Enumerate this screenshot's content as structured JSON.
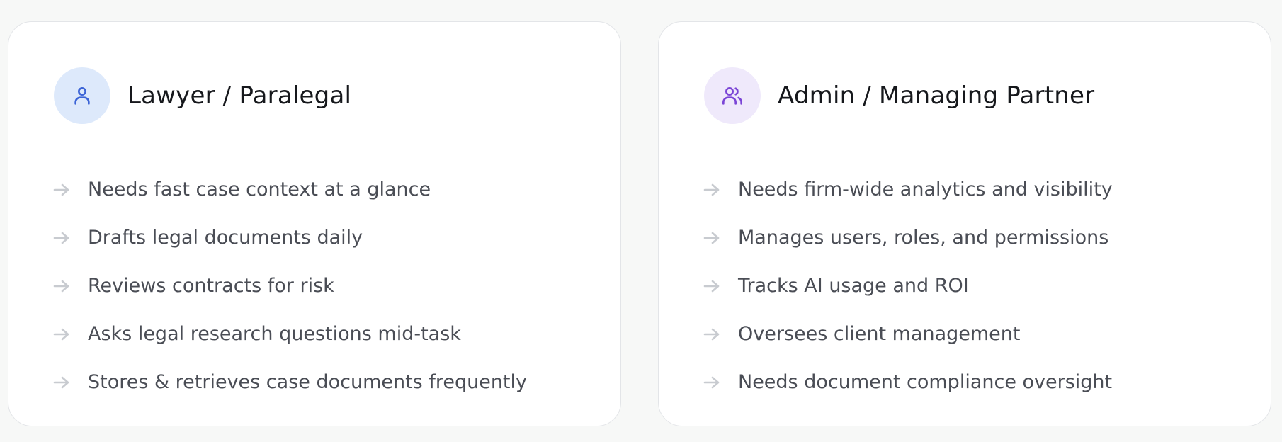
{
  "cards": [
    {
      "title": "Lawyer / Paralegal",
      "icon": "user-icon",
      "icon_bg": "#dde9fb",
      "icon_color": "#3c64d6",
      "items": [
        "Needs fast case context at a glance",
        "Drafts legal documents daily",
        "Reviews contracts for risk",
        "Asks legal research questions mid-task",
        "Stores & retrieves case documents frequently"
      ]
    },
    {
      "title": "Admin / Managing Partner",
      "icon": "users-icon",
      "icon_bg": "#efe9fb",
      "icon_color": "#7b45d6",
      "items": [
        "Needs firm-wide analytics and visibility",
        "Manages users, roles, and permissions",
        "Tracks AI usage and ROI",
        "Oversees client management",
        "Needs document compliance oversight"
      ]
    }
  ],
  "bullet_icon": "arrow-right-icon",
  "bullet_color": "#c8cbd0"
}
